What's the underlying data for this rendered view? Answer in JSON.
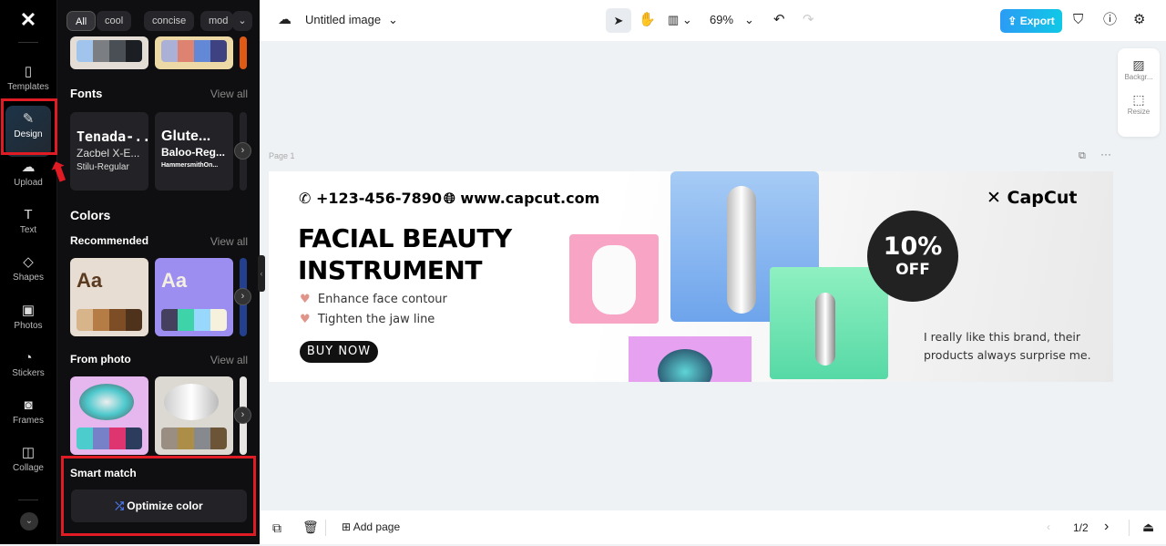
{
  "rail": {
    "logo": "CapCut",
    "items": [
      {
        "label": "Templates",
        "icon": "templates-icon",
        "glyph": "▯"
      },
      {
        "label": "Design",
        "icon": "design-icon",
        "glyph": "✎",
        "active": true
      },
      {
        "label": "Upload",
        "icon": "upload-cloud-icon",
        "glyph": "☁"
      },
      {
        "label": "Text",
        "icon": "text-icon",
        "glyph": "T"
      },
      {
        "label": "Shapes",
        "icon": "shapes-icon",
        "glyph": "◇"
      },
      {
        "label": "Photos",
        "icon": "photos-icon",
        "glyph": "▣"
      },
      {
        "label": "Stickers",
        "icon": "stickers-icon",
        "glyph": "◔"
      },
      {
        "label": "Frames",
        "icon": "frames-icon",
        "glyph": "◙"
      },
      {
        "label": "Collage",
        "icon": "collage-icon",
        "glyph": "◫"
      }
    ]
  },
  "panel": {
    "chips": [
      "All",
      "cool",
      "concise",
      "mod"
    ],
    "top_palettes": [
      [
        "#a0c4ec",
        "#7b7f84",
        "#4a4e55",
        "#1b1e22"
      ],
      [
        "#aab0d6",
        "#de8272",
        "#6388d6",
        "#3e4280"
      ]
    ],
    "fonts": {
      "title": "Fonts",
      "view_all": "View all",
      "cards": [
        [
          "Tenada-...",
          "Zacbel X-E...",
          "Stilu-Regular"
        ],
        [
          "Glute...",
          "Baloo-Reg...",
          "HammersmithOn..."
        ]
      ]
    },
    "colors": {
      "title": "Colors",
      "recommended": "Recommended",
      "view_all": "View all",
      "cards": [
        {
          "sample": "Aa",
          "bg": "#e8ddd2",
          "fg": "#5a3a20",
          "swatches": [
            "#d7b48a",
            "#b57c45",
            "#7d4e26",
            "#4e321c"
          ]
        },
        {
          "sample": "Aa",
          "bg": "#9b8ef0",
          "fg": "#f4efe0",
          "swatches": [
            "#44405e",
            "#3fd3aa",
            "#98d8fc",
            "#f5f1dc"
          ]
        }
      ]
    },
    "from_photo": {
      "title": "From photo",
      "view_all": "View all",
      "cards": [
        {
          "bg": "#e6b6ef",
          "swatches": [
            "#4ccccc",
            "#7681c8",
            "#de3470",
            "#2c3c5c"
          ]
        },
        {
          "bg": "#dcd8d2",
          "swatches": [
            "#9a8e82",
            "#ad8e48",
            "#868a8e",
            "#6c5536"
          ]
        }
      ]
    },
    "smart_match": {
      "title": "Smart match",
      "button": "Optimize color"
    }
  },
  "topbar": {
    "title": "Untitled image",
    "zoom": "69%",
    "export": "Export"
  },
  "sidetools": [
    {
      "label": "Backgr..."
    },
    {
      "label": "Resize"
    }
  ],
  "canvas": {
    "page_label": "Page 1"
  },
  "banner": {
    "phone": "+123-456-7890",
    "website": "www.capcut.com",
    "headline1": "FACIAL BEAUTY",
    "headline2": "INSTRUMENT",
    "bullets": [
      "Enhance face contour",
      "Tighten the jaw line"
    ],
    "cta": "BUY NOW",
    "brand": "CapCut",
    "badge_big": "10%",
    "badge_small": "OFF",
    "quote1": "I really like this brand, their",
    "quote2": "products always surprise me."
  },
  "bottombar": {
    "add_page": "Add page",
    "pagination": "1/2"
  }
}
